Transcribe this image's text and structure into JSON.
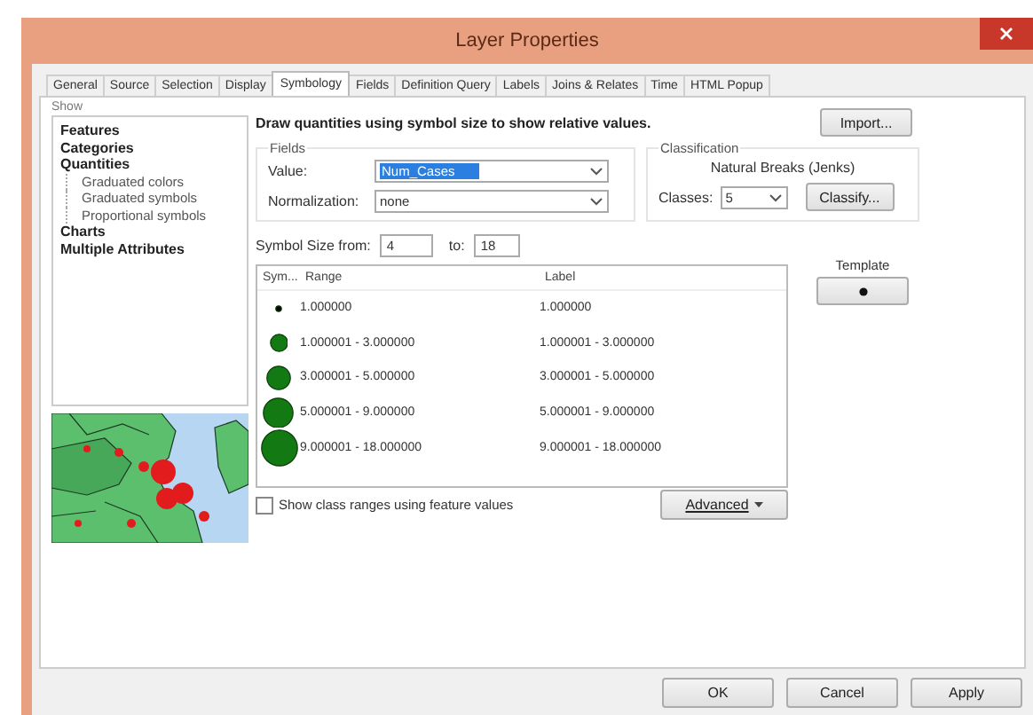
{
  "window": {
    "title": "Layer Properties"
  },
  "tabs": [
    {
      "label": "General",
      "selected": false
    },
    {
      "label": "Source",
      "selected": false
    },
    {
      "label": "Selection",
      "selected": false
    },
    {
      "label": "Display",
      "selected": false
    },
    {
      "label": "Symbology",
      "selected": true
    },
    {
      "label": "Fields",
      "selected": false
    },
    {
      "label": "Definition Query",
      "selected": false
    },
    {
      "label": "Labels",
      "selected": false
    },
    {
      "label": "Joins & Relates",
      "selected": false
    },
    {
      "label": "Time",
      "selected": false
    },
    {
      "label": "HTML Popup",
      "selected": false
    }
  ],
  "show": {
    "label": "Show",
    "items": [
      {
        "label": "Features"
      },
      {
        "label": "Categories"
      },
      {
        "label": "Quantities",
        "children": [
          {
            "label": "Graduated colors"
          },
          {
            "label": "Graduated symbols"
          },
          {
            "label": "Proportional symbols"
          }
        ]
      },
      {
        "label": "Charts"
      },
      {
        "label": "Multiple Attributes"
      }
    ]
  },
  "description": "Draw quantities using symbol size to show relative values.",
  "import_button": "Import...",
  "fields": {
    "label": "Fields",
    "value_label": "Value:",
    "value": "Num_Cases",
    "normalization_label": "Normalization:",
    "normalization": "none"
  },
  "classification": {
    "label": "Classification",
    "method": "Natural Breaks (Jenks)",
    "classes_label": "Classes:",
    "classes": "5",
    "classify_button": "Classify..."
  },
  "symbol_size": {
    "label": "Symbol Size from:",
    "from": "4",
    "to_label": "to:",
    "to": "18"
  },
  "template": {
    "label": "Template"
  },
  "table": {
    "columns": [
      "Sym...",
      "Range",
      "Label"
    ],
    "rows": [
      {
        "color": "#000000",
        "range": "1.000000",
        "label": "1.000000"
      },
      {
        "color": "#137a13",
        "range": "1.000001 - 3.000000",
        "label": "1.000001 - 3.000000"
      },
      {
        "color": "#137a13",
        "range": "3.000001 - 5.000000",
        "label": "3.000001 - 5.000000"
      },
      {
        "color": "#137a13",
        "range": "5.000001 - 9.000000",
        "label": "5.000001 - 9.000000"
      },
      {
        "color": "#137a13",
        "range": "9.000001 - 18.000000",
        "label": "9.000001 - 18.000000"
      }
    ]
  },
  "show_class_ranges": {
    "label": "Show class ranges using feature values",
    "checked": false
  },
  "advanced_button": "Advanced",
  "buttons": [
    "OK",
    "Cancel",
    "Apply"
  ]
}
